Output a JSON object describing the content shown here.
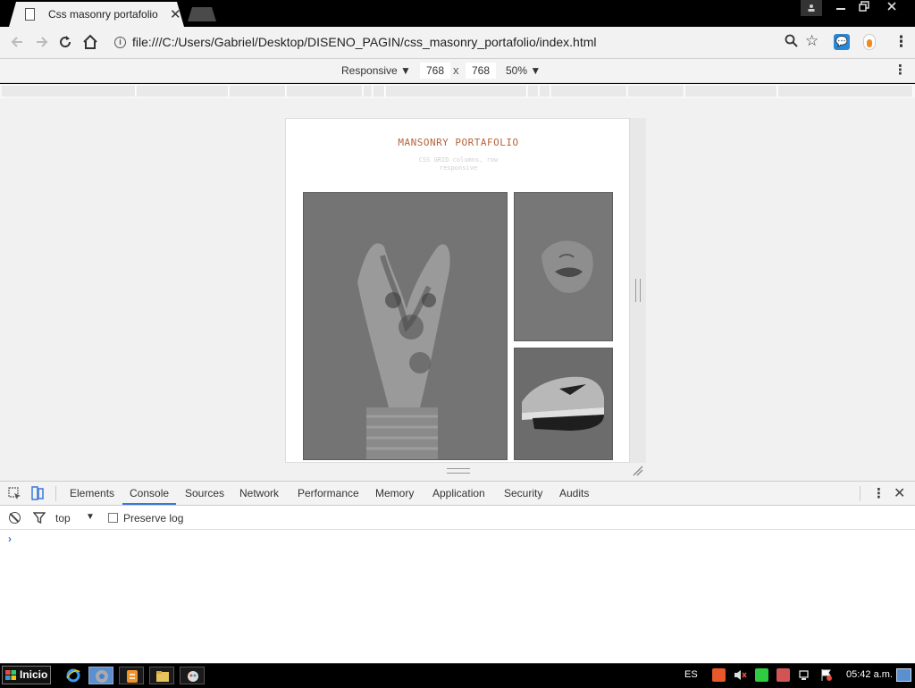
{
  "browser": {
    "tab_title": "Css masonry portafolio",
    "tab_close": "✕",
    "address": "file:///C:/Users/Gabriel/Desktop/DISENO_PAGIN/css_masonry_portafolio/index.html"
  },
  "device_toolbar": {
    "device": "Responsive ▼",
    "width": "768",
    "times": "x",
    "height": "768",
    "zoom": "50% ▼"
  },
  "page": {
    "title": "MANSONRY PORTAFOLIO",
    "subtitle": "CSS GRID columns, row responsive"
  },
  "devtools": {
    "tabs": [
      "Elements",
      "Console",
      "Sources",
      "Network",
      "Performance",
      "Memory",
      "Application",
      "Security",
      "Audits"
    ],
    "active_tab": "Console",
    "context": "top",
    "preserve_log": "Preserve log",
    "prompt": "›"
  },
  "taskbar": {
    "start": "Inicio",
    "language": "ES",
    "clock": "05:42 a.m."
  },
  "colors": {
    "accent": "#3879d9",
    "page_title": "#b5633b"
  }
}
